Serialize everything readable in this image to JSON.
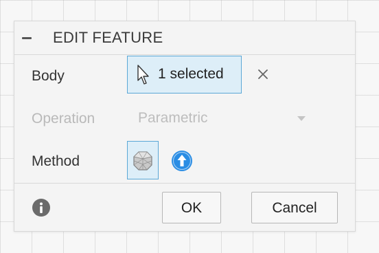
{
  "dialog": {
    "title": "EDIT FEATURE",
    "collapse_icon": "minus-icon"
  },
  "body_row": {
    "label": "Body",
    "selection_text": "1 selected",
    "selection_icon": "cursor-arrow-icon",
    "clear_icon": "close-x-icon"
  },
  "operation_row": {
    "label": "Operation",
    "value": "Parametric",
    "disabled": true,
    "dropdown_icon": "chevron-down-icon"
  },
  "method_row": {
    "label": "Method",
    "options": [
      {
        "icon": "mesh-cube-icon",
        "selected": true
      },
      {
        "icon": "blue-upload-arrow-icon",
        "selected": false
      }
    ]
  },
  "footer": {
    "info_icon": "info-icon",
    "ok_label": "OK",
    "cancel_label": "Cancel"
  },
  "colors": {
    "accent_border": "#5aa7d6",
    "selected_bg": "#ddeef8",
    "blue_icon": "#2a8de4",
    "disabled_text": "#b9b9b9"
  }
}
